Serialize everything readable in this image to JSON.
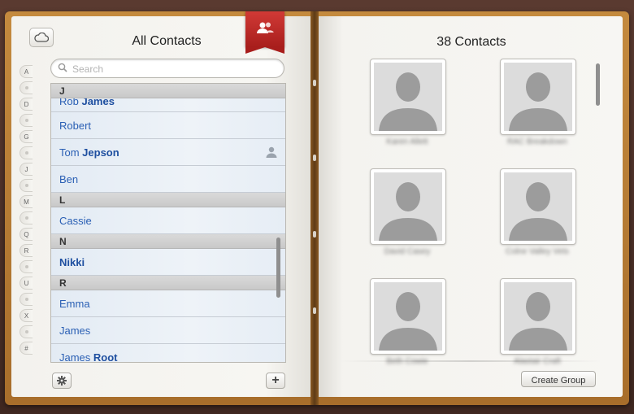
{
  "left_page": {
    "title": "All Contacts",
    "search": {
      "placeholder": "Search",
      "value": ""
    },
    "index_letters": [
      "A",
      "",
      "D",
      "",
      "G",
      "",
      "J",
      "",
      "M",
      "",
      "Q",
      "R",
      "",
      "U",
      "",
      "X",
      "",
      "#"
    ],
    "contacts": [
      {
        "type": "header",
        "text": "J"
      },
      {
        "type": "row",
        "first": "Rob",
        "last": "James",
        "clipped": true
      },
      {
        "type": "row",
        "first": "Robert",
        "last": ""
      },
      {
        "type": "row",
        "first": "Tom",
        "last": "Jepson",
        "me": true
      },
      {
        "type": "row",
        "first": "Ben",
        "last": ""
      },
      {
        "type": "header",
        "text": "L"
      },
      {
        "type": "row",
        "first": "Cassie",
        "last": ""
      },
      {
        "type": "header",
        "text": "N"
      },
      {
        "type": "row",
        "first": "",
        "last": "Nikki"
      },
      {
        "type": "header",
        "text": "R"
      },
      {
        "type": "row",
        "first": "Emma",
        "last": ""
      },
      {
        "type": "row",
        "first": "James",
        "last": ""
      },
      {
        "type": "row",
        "first": "James",
        "last": "Root"
      }
    ]
  },
  "right_page": {
    "title": "38 Contacts",
    "cards": [
      {
        "name": "Karen Allett"
      },
      {
        "name": "RAC Breakdown"
      },
      {
        "name": "David Casey"
      },
      {
        "name": "Colne Valley Vets"
      },
      {
        "name": "Beth Cowie"
      },
      {
        "name": "Alastair Craft"
      }
    ],
    "create_group_label": "Create Group"
  },
  "icons": {
    "cloud": "cloud-icon",
    "bookmark": "contacts-group-icon",
    "search": "search-icon",
    "gear": "gear-icon",
    "plus": "plus-icon",
    "me_card": "person-icon"
  },
  "colors": {
    "link_blue": "#2a5fb4",
    "bookmark_red": "#c52d2a",
    "cover_brown": "#b27632",
    "leather": "#4a2e26"
  }
}
